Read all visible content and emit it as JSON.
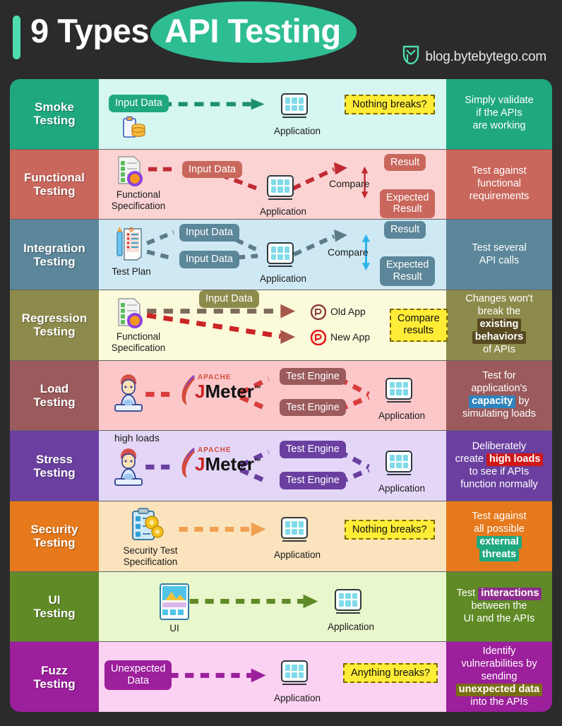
{
  "header": {
    "title_plain": "9 Types",
    "title_highlight": "API Testing",
    "brand": "blog.bytebytego.com",
    "brand_icon": "bytebytego-logo-icon",
    "accent": "#2ebd92",
    "bar_color": "#4fdcb0"
  },
  "common": {
    "application_label": "Application",
    "input_data_label": "Input Data",
    "test_engine_label": "Test Engine",
    "nothing_breaks_label": "Nothing breaks?",
    "compare_label": "Compare",
    "result_label": "Result",
    "expected_result_label": "Expected\nResult",
    "app_icon": "application-monitor-icon"
  },
  "rows": [
    {
      "type": "Smoke\nTesting",
      "type_line1": "Smoke",
      "type_line2": "Testing",
      "type_bg": "#1fa880",
      "diagram_bg": "#d6f6f2",
      "desc_bg": "#1fa880",
      "desc_lines": [
        "Simply validate",
        "if the APIs",
        "are working"
      ],
      "pill_color": "#1fa880",
      "arrow_color": "#1b8f6e",
      "nodes": {
        "input_data": "Input Data",
        "application": "Application",
        "note": "Nothing breaks?",
        "source_icon": "clipboard-database-icon"
      }
    },
    {
      "type_line1": "Functional",
      "type_line2": "Testing",
      "type_bg": "#c9675c",
      "diagram_bg": "#fbd3d3",
      "desc_bg": "#c9675c",
      "desc_lines": [
        "Test against",
        "functional",
        "requirements"
      ],
      "pill_color": "#c9675c",
      "arrow_color": "#c12b33",
      "nodes": {
        "spec_caption_1": "Functional",
        "spec_caption_2": "Specification",
        "spec_icon": "document-gear-icon",
        "input_data": "Input Data",
        "application": "Application",
        "compare": "Compare",
        "result": "Result",
        "expected_1": "Expected",
        "expected_2": "Result"
      }
    },
    {
      "type_line1": "Integration",
      "type_line2": "Testing",
      "type_bg": "#5c8699",
      "diagram_bg": "#cfe9f4",
      "desc_bg": "#5c8699",
      "desc_lines": [
        "Test several",
        "API calls"
      ],
      "pill_color": "#5c8699",
      "arrow_color": "#4a6d7c",
      "nodes": {
        "plan_caption": "Test Plan",
        "plan_icon": "test-plan-clipboard-icon",
        "input_data_1": "Input Data",
        "input_data_2": "Input Data",
        "application": "Application",
        "compare": "Compare",
        "result": "Result",
        "expected_1": "Expected",
        "expected_2": "Result"
      }
    },
    {
      "type_line1": "Regression",
      "type_line2": "Testing",
      "type_bg": "#8d8b4b",
      "diagram_bg": "#fbfadb",
      "desc_bg": "#8d8b4b",
      "desc_lines": [
        "Changes won't",
        "break the"
      ],
      "desc_hl": [
        "existing",
        "behaviors"
      ],
      "desc_tail": "of APIs",
      "desc_hl_bg": "#584a21",
      "pill_color": "#8d8b4b",
      "arrow_color_old": "#7c6a5b",
      "arrow_color_new": "#cc2424",
      "nodes": {
        "spec_caption_1": "Functional",
        "spec_caption_2": "Specification",
        "spec_icon": "document-gear-icon",
        "input_data": "Input Data",
        "old_app": "Old App",
        "new_app": "New App",
        "old_app_icon": "old-app-circle-icon",
        "new_app_icon": "new-app-circle-icon",
        "note_1": "Compare",
        "note_2": "results"
      }
    },
    {
      "type_line1": "Load",
      "type_line2": "Testing",
      "type_bg": "#9b5a5c",
      "diagram_bg": "#fbc7c9",
      "desc_bg": "#9b5a5c",
      "desc_lines": [
        "Test for",
        "application's"
      ],
      "desc_hl": "capacity",
      "desc_hl_bg": "#2f84bd",
      "desc_after_hl": " by",
      "desc_tail": "simulating loads",
      "pill_color": "#9b5a5c",
      "arrow_color": "#d93c3c",
      "nodes": {
        "user_icon": "user-laptop-icon",
        "jmeter_brand_top": "APACHE",
        "jmeter_brand": "JMeter",
        "jmeter_tm": "™",
        "jmeter_icon": "apache-jmeter-logo-icon",
        "test_engine_1": "Test Engine",
        "test_engine_2": "Test Engine",
        "application": "Application"
      }
    },
    {
      "type_line1": "Stress",
      "type_line2": "Testing",
      "type_bg": "#6a3fa0",
      "diagram_bg": "#e3d6f7",
      "desc_bg": "#6a3fa0",
      "desc_lines": [
        "Deliberately"
      ],
      "desc_prefix": "create ",
      "desc_hl": "high loads",
      "desc_hl_bg": "#cf1717",
      "desc_tail_1": "to see if APIs",
      "desc_tail_2": "function normally",
      "pill_color": "#6a3fa0",
      "arrow_color": "#6a3fa0",
      "nodes": {
        "high_loads": "high loads",
        "user_icon": "user-laptop-icon",
        "jmeter_brand_top": "APACHE",
        "jmeter_brand": "JMeter",
        "jmeter_tm": "™",
        "jmeter_icon": "apache-jmeter-logo-icon",
        "test_engine_1": "Test Engine",
        "test_engine_2": "Test Engine",
        "application": "Application"
      }
    },
    {
      "type_line1": "Security",
      "type_line2": "Testing",
      "type_bg": "#e5791b",
      "diagram_bg": "#fbe3bd",
      "desc_bg": "#e5791b",
      "desc_lines": [
        "Test against",
        "all possible"
      ],
      "desc_hl": [
        "external",
        "threats"
      ],
      "desc_hl_bg": "#1fa880",
      "pill_color": "#e5791b",
      "arrow_color": "#f0a050",
      "nodes": {
        "spec_caption_1": "Security Test",
        "spec_caption_2": "Specification",
        "spec_icon": "security-clipboard-gear-icon",
        "application": "Application",
        "note": "Nothing breaks?"
      }
    },
    {
      "type_line1": "UI",
      "type_line2": "Testing",
      "type_bg": "#5f8a26",
      "diagram_bg": "#e9f7cc",
      "desc_bg": "#5f8a26",
      "desc_prefix": "Test ",
      "desc_hl": "interactions",
      "desc_hl_bg": "#8d2d8d",
      "desc_tail_1": "between the",
      "desc_tail_2": "UI and the APIs",
      "pill_color": "#5f8a26",
      "arrow_color": "#5f8a26",
      "nodes": {
        "ui_caption": "UI",
        "ui_icon": "ui-screen-icon",
        "application": "Application"
      }
    },
    {
      "type_line1": "Fuzz",
      "type_line2": "Testing",
      "type_bg": "#9c1f9c",
      "diagram_bg": "#fbd2f2",
      "desc_bg": "#9c1f9c",
      "desc_lines": [
        "Identify",
        "vulnerabilities by",
        "sending"
      ],
      "desc_hl": "unexpected data",
      "desc_hl_bg": "#7a6d14",
      "desc_tail": "into the APIs",
      "pill_color": "#9c1f9c",
      "arrow_color": "#9c1f9c",
      "nodes": {
        "unexpected_1": "Unexpected",
        "unexpected_2": "Data",
        "application": "Application",
        "note": "Anything breaks?"
      }
    }
  ]
}
